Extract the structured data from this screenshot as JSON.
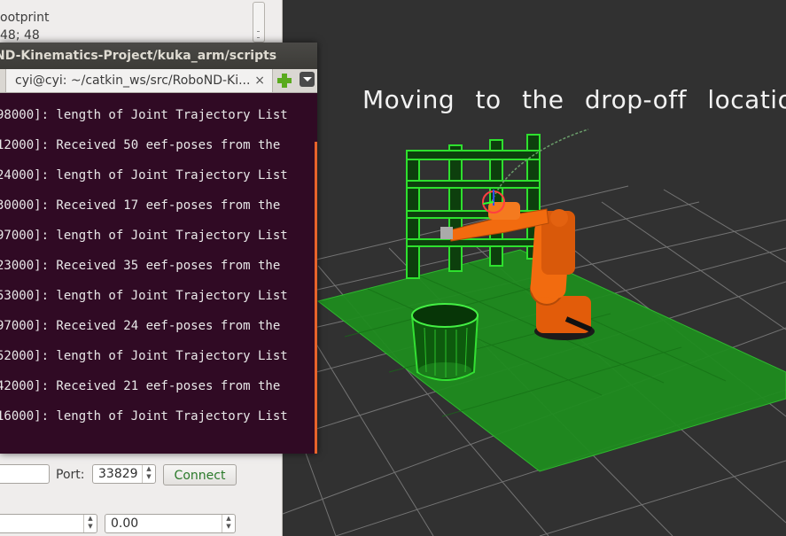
{
  "left_panel": {
    "prop_name": "ootprint",
    "prop_value": "48; 48",
    "port_label": "Port:",
    "port_value": "33829",
    "connect_label": "Connect",
    "bottom_value": "0.00"
  },
  "viewport": {
    "overlay_text": "Moving to the drop-off location",
    "floor_color": "#1f8c1f",
    "grid_color": "#9a9a9a",
    "robot_color": "#f26b0f"
  },
  "terminal": {
    "title": "ND-Kinematics-Project/kuka_arm/scripts",
    "tab_label": "cyi@cyi: ~/catkin_ws/src/RoboND-Ki...",
    "tab_close": "×",
    "lines": [
      "98000]: length of Joint Trajectory List",
      "12000]: Received 50 eef-poses from the",
      "24000]: length of Joint Trajectory List",
      "30000]: Received 17 eef-poses from the",
      "97000]: length of Joint Trajectory List",
      "23000]: Received 35 eef-poses from the",
      "53000]: length of Joint Trajectory List",
      "97000]: Received 24 eef-poses from the",
      "52000]: length of Joint Trajectory List",
      "42000]: Received 21 eef-poses from the",
      "16000]: length of Joint Trajectory List"
    ]
  },
  "icons": [
    "new-tab-icon",
    "chevron-down-icon",
    "close-icon"
  ]
}
